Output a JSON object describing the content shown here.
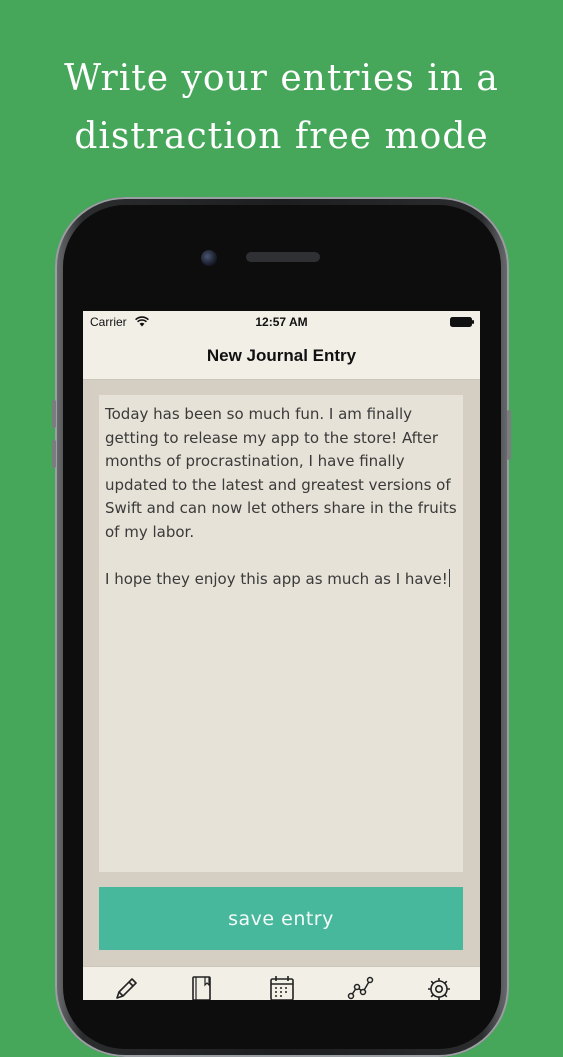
{
  "headline": {
    "line1": "Write your entries in a",
    "line2": "distraction free mode"
  },
  "status_bar": {
    "carrier": "Carrier",
    "time": "12:57 AM"
  },
  "nav": {
    "title": "New Journal Entry"
  },
  "editor": {
    "text": "Today has been so much fun. I am finally\ngetting to release my app to the store! After\nmonths of procrastination, I have finally\nupdated to the latest and greatest versions of\nSwift and can now let others share in the fruits\nof my labor.\n\nI hope they enjoy this app as much as I have!"
  },
  "save_button": {
    "label": "save entry"
  },
  "tabs": [
    {
      "icon": "pencil-icon"
    },
    {
      "icon": "journal-icon"
    },
    {
      "icon": "calendar-icon"
    },
    {
      "icon": "chart-icon"
    },
    {
      "icon": "gear-icon"
    }
  ],
  "colors": {
    "background": "#46a75a",
    "accent": "#47b89c",
    "screen_bg": "#d4cfc2",
    "editor_bg": "#e6e2d7",
    "bar_bg": "#f2efe7"
  }
}
